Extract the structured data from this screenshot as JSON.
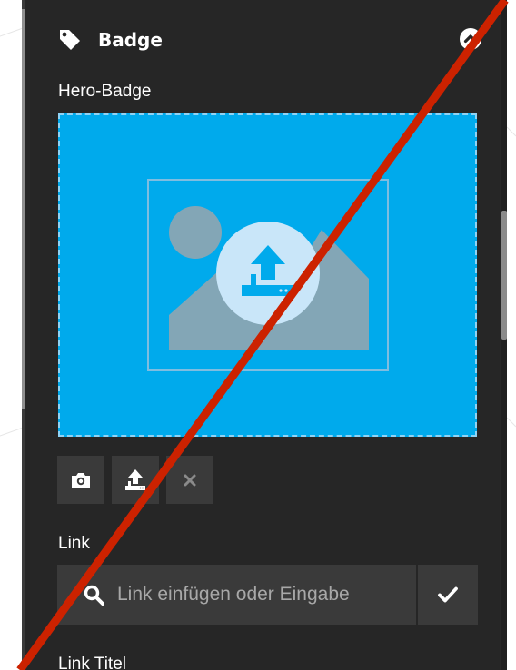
{
  "panel": {
    "section": {
      "icon": "tag-icon",
      "title": "Badge",
      "collapse_icon": "chevron-up-icon"
    },
    "image_field": {
      "label": "Hero-Badge",
      "placeholder_icon": "image-placeholder-icon",
      "upload_icon": "upload-icon",
      "actions": [
        {
          "name": "camera",
          "icon": "camera-icon"
        },
        {
          "name": "upload",
          "icon": "upload-icon"
        },
        {
          "name": "remove",
          "icon": "close-icon"
        }
      ]
    },
    "link_field": {
      "label": "Link",
      "placeholder": "Link einfügen oder Eingabe",
      "search_icon": "search-icon",
      "confirm_icon": "check-icon"
    },
    "link_title_field": {
      "label": "Link Titel"
    }
  },
  "colors": {
    "panel_background": "#262626",
    "dropzone_background": "#00aaec",
    "overlay_slash": "#cc2200"
  }
}
